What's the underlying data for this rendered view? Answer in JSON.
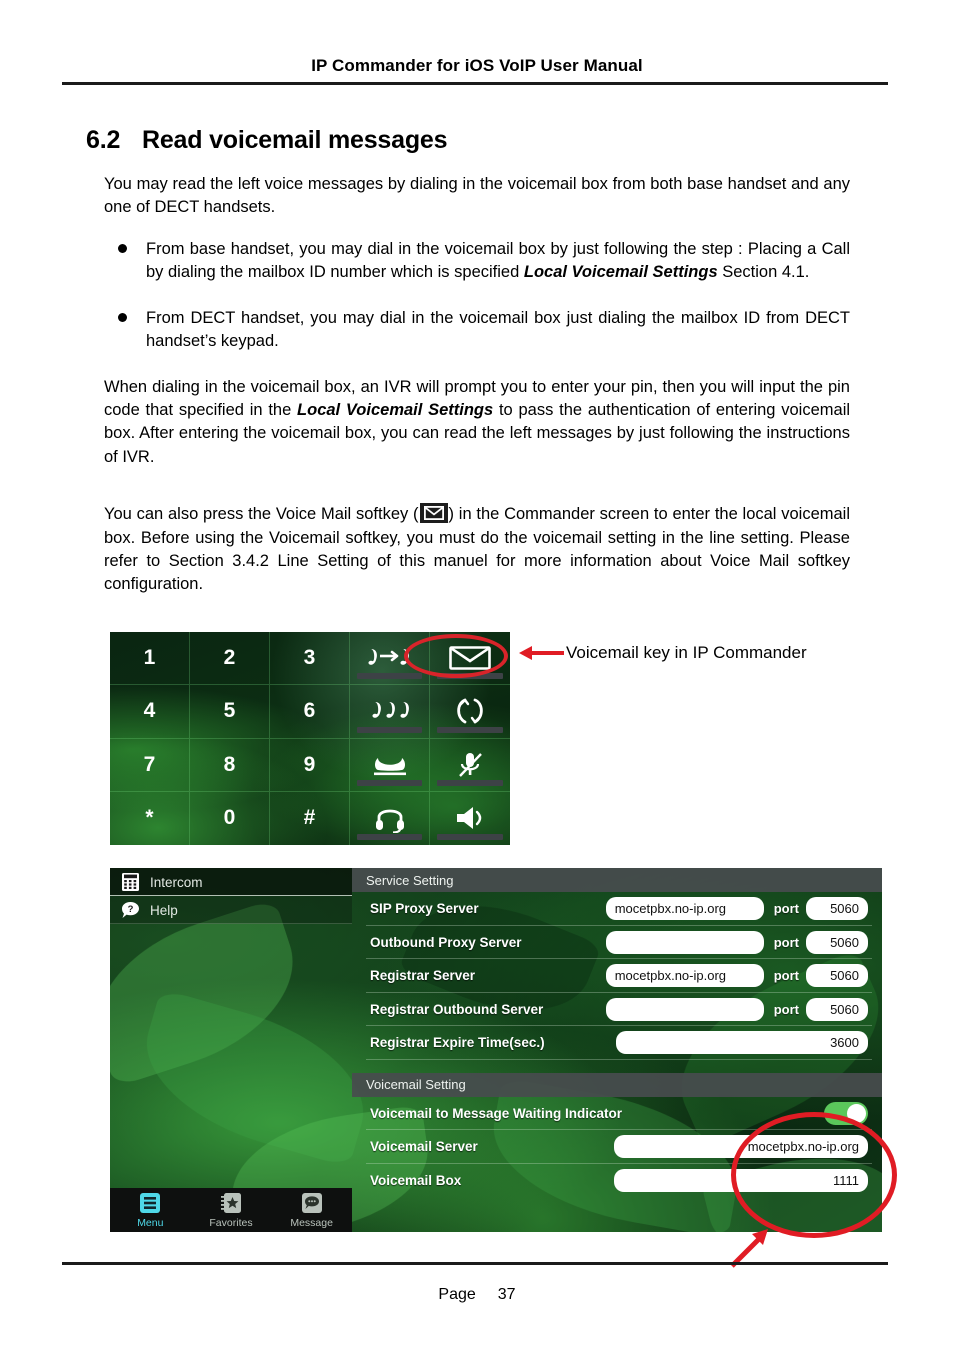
{
  "header": {
    "title": "IP Commander for iOS VoIP User Manual"
  },
  "footer": {
    "page_label": "Page",
    "page_number": "37"
  },
  "section": {
    "number": "6.2",
    "heading": "Read voicemail messages",
    "intro": "You may read the left voice messages by dialing in the voicemail box from both base handset and any one of DECT handsets.",
    "bullets": [
      {
        "part1": "From base handset, you may dial in the voicemail box by just following the step : Placing a Call by dialing the mailbox ID number which is specified ",
        "emphasis": "Local Voicemail Settings",
        "part2": " Section 4.1."
      },
      {
        "part1": "From DECT handset, you may dial in the voicemail box just dialing the mailbox ID from DECT handset’s keypad.",
        "emphasis": "",
        "part2": ""
      }
    ],
    "para2_part1": "When dialing in the voicemail box, an IVR will prompt you to enter your pin, then you will input the pin code that specified in the ",
    "para2_emphasis": "Local Voicemail Settings",
    "para2_part2": " to pass the authentication of entering voicemail box.   After entering the voicemail box, you can read the left messages by just following the instructions of IVR.",
    "para3_part1": "You can also press the Voice Mail softkey (",
    "para3_part2": ") in the Commander screen to enter the local voicemail box.   Before using the Voicemail softkey, you must do the voicemail setting in the line setting.   Please refer to Section 3.4.2 Line Setting of this manuel for more information about Voice Mail softkey configuration."
  },
  "keypad_figure": {
    "annotation": "Voicemail key in IP Commander",
    "keys": [
      {
        "label": "1",
        "type": "digit"
      },
      {
        "label": "2",
        "type": "digit"
      },
      {
        "label": "3",
        "type": "digit"
      },
      {
        "label": "",
        "type": "icon",
        "icon": "call-transfer-icon"
      },
      {
        "label": "",
        "type": "icon",
        "icon": "voicemail-envelope-icon"
      },
      {
        "label": "4",
        "type": "digit"
      },
      {
        "label": "5",
        "type": "digit"
      },
      {
        "label": "6",
        "type": "digit"
      },
      {
        "label": "",
        "type": "icon",
        "icon": "conference-icon"
      },
      {
        "label": "",
        "type": "icon",
        "icon": "hold-swap-icon"
      },
      {
        "label": "7",
        "type": "digit"
      },
      {
        "label": "8",
        "type": "digit"
      },
      {
        "label": "9",
        "type": "digit"
      },
      {
        "label": "",
        "type": "icon",
        "icon": "end-call-icon"
      },
      {
        "label": "",
        "type": "icon",
        "icon": "mute-microphone-icon"
      },
      {
        "label": "*",
        "type": "digit"
      },
      {
        "label": "0",
        "type": "digit"
      },
      {
        "label": "#",
        "type": "digit"
      },
      {
        "label": "",
        "type": "icon",
        "icon": "headset-icon"
      },
      {
        "label": "",
        "type": "icon",
        "icon": "speaker-icon"
      }
    ]
  },
  "app_figure": {
    "menu": [
      {
        "label": "Intercom",
        "icon": "dialpad-icon"
      },
      {
        "label": "Help",
        "icon": "help-bubble-icon"
      }
    ],
    "tabs": [
      {
        "label": "Menu",
        "icon": "menu-list-icon",
        "active": true
      },
      {
        "label": "Favorites",
        "icon": "favorites-star-icon",
        "active": false
      },
      {
        "label": "Message",
        "icon": "message-bubble-icon",
        "active": false
      }
    ],
    "service_setting": {
      "title": "Service Setting",
      "port_label": "port",
      "rows": [
        {
          "label": "SIP Proxy Server",
          "value": "mocetpbx.no-ip.org",
          "port": "5060"
        },
        {
          "label": "Outbound Proxy Server",
          "value": "",
          "port": "5060"
        },
        {
          "label": "Registrar Server",
          "value": "mocetpbx.no-ip.org",
          "port": "5060"
        },
        {
          "label": "Registrar Outbound Server",
          "value": "",
          "port": "5060"
        },
        {
          "label": "Registrar Expire Time(sec.)",
          "value": "3600",
          "port": null
        }
      ]
    },
    "voicemail_setting": {
      "title": "Voicemail Setting",
      "toggle_row_label": "Voicemail to Message Waiting Indicator",
      "toggle_on": true,
      "rows": [
        {
          "label": "Voicemail Server",
          "value": "mocetpbx.no-ip.org"
        },
        {
          "label": "Voicemail Box",
          "value": "1111"
        }
      ]
    }
  },
  "colors": {
    "annotation_red": "#d8242a",
    "toggle_green": "#5bc75b",
    "tab_active": "#4fd8e8"
  }
}
